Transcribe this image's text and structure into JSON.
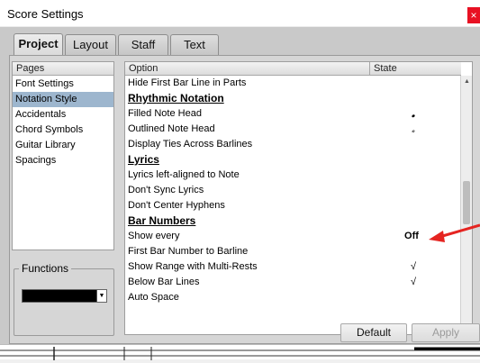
{
  "window": {
    "title": "Score Settings",
    "close_glyph": "×"
  },
  "tabs": [
    {
      "label": "Project",
      "active": true
    },
    {
      "label": "Layout",
      "active": false
    },
    {
      "label": "Staff",
      "active": false
    },
    {
      "label": "Text",
      "active": false
    }
  ],
  "pages": {
    "header": "Pages",
    "items": [
      {
        "label": "Font Settings",
        "selected": false
      },
      {
        "label": "Notation Style",
        "selected": true
      },
      {
        "label": "Accidentals",
        "selected": false
      },
      {
        "label": "Chord Symbols",
        "selected": false
      },
      {
        "label": "Guitar Library",
        "selected": false
      },
      {
        "label": "Spacings",
        "selected": false
      }
    ],
    "selected_color": "#9db6ce"
  },
  "functions": {
    "label": "Functions",
    "selected_value": ""
  },
  "options": {
    "header_option": "Option",
    "header_state": "State",
    "rows": [
      {
        "label": "Hide First Bar Line in Parts",
        "type": "item",
        "state": ""
      },
      {
        "label": "Rhythmic Notation",
        "type": "heading",
        "state": ""
      },
      {
        "label": "Filled Note Head",
        "type": "item",
        "state": "𝅘",
        "state_icon": "filled-notehead-icon"
      },
      {
        "label": "Outlined Note Head",
        "type": "item",
        "state": "𝅗",
        "state_icon": "outlined-notehead-icon"
      },
      {
        "label": "Display Ties Across Barlines",
        "type": "item",
        "state": ""
      },
      {
        "label": "Lyrics",
        "type": "heading",
        "state": ""
      },
      {
        "label": "Lyrics left-aligned to Note",
        "type": "item",
        "state": ""
      },
      {
        "label": "Don't Sync Lyrics",
        "type": "item",
        "state": ""
      },
      {
        "label": "Don't Center Hyphens",
        "type": "item",
        "state": ""
      },
      {
        "label": "Bar Numbers",
        "type": "heading",
        "state": ""
      },
      {
        "label": "Show every",
        "type": "item",
        "state": "Off"
      },
      {
        "label": "First Bar Number to Barline",
        "type": "item",
        "state": ""
      },
      {
        "label": "Show Range with Multi-Rests",
        "type": "item",
        "state": "√"
      },
      {
        "label": "Below Bar Lines",
        "type": "item",
        "state": "√"
      },
      {
        "label": "Auto Space",
        "type": "item",
        "state": ""
      }
    ]
  },
  "scrollbar": {
    "up_glyph": "▲",
    "down_glyph": "▼",
    "position": 0.5
  },
  "buttons": {
    "default_label": "Default",
    "apply_label": "Apply"
  },
  "annotation": {
    "arrow_color": "#e52421"
  }
}
